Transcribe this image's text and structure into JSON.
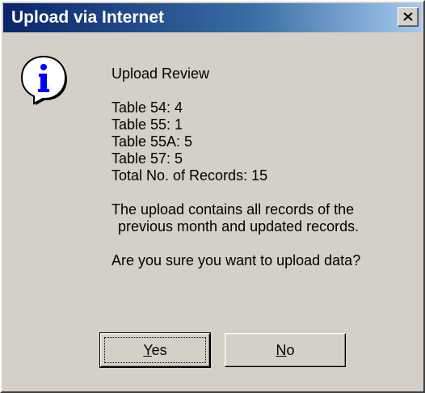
{
  "window": {
    "title": "Upload via Internet",
    "close_icon": "close-icon"
  },
  "dialog": {
    "icon": "information-icon",
    "heading": "Upload Review",
    "counts": [
      "Table 54: 4",
      "Table 55: 1",
      "Table 55A: 5",
      "Table 57: 5",
      "Total No. of Records: 15"
    ],
    "note_lines": [
      "The upload contains all records of the",
      "previous month and updated records."
    ],
    "question": "Are you sure you want to upload data?"
  },
  "buttons": {
    "yes": {
      "mnemonic": "Y",
      "rest": "es"
    },
    "no": {
      "mnemonic": "N",
      "rest": "o"
    }
  },
  "colors": {
    "face": "#d4d0c8",
    "title_start": "#0a246a",
    "title_end": "#a6caf0",
    "icon_blue": "#0000ff"
  }
}
